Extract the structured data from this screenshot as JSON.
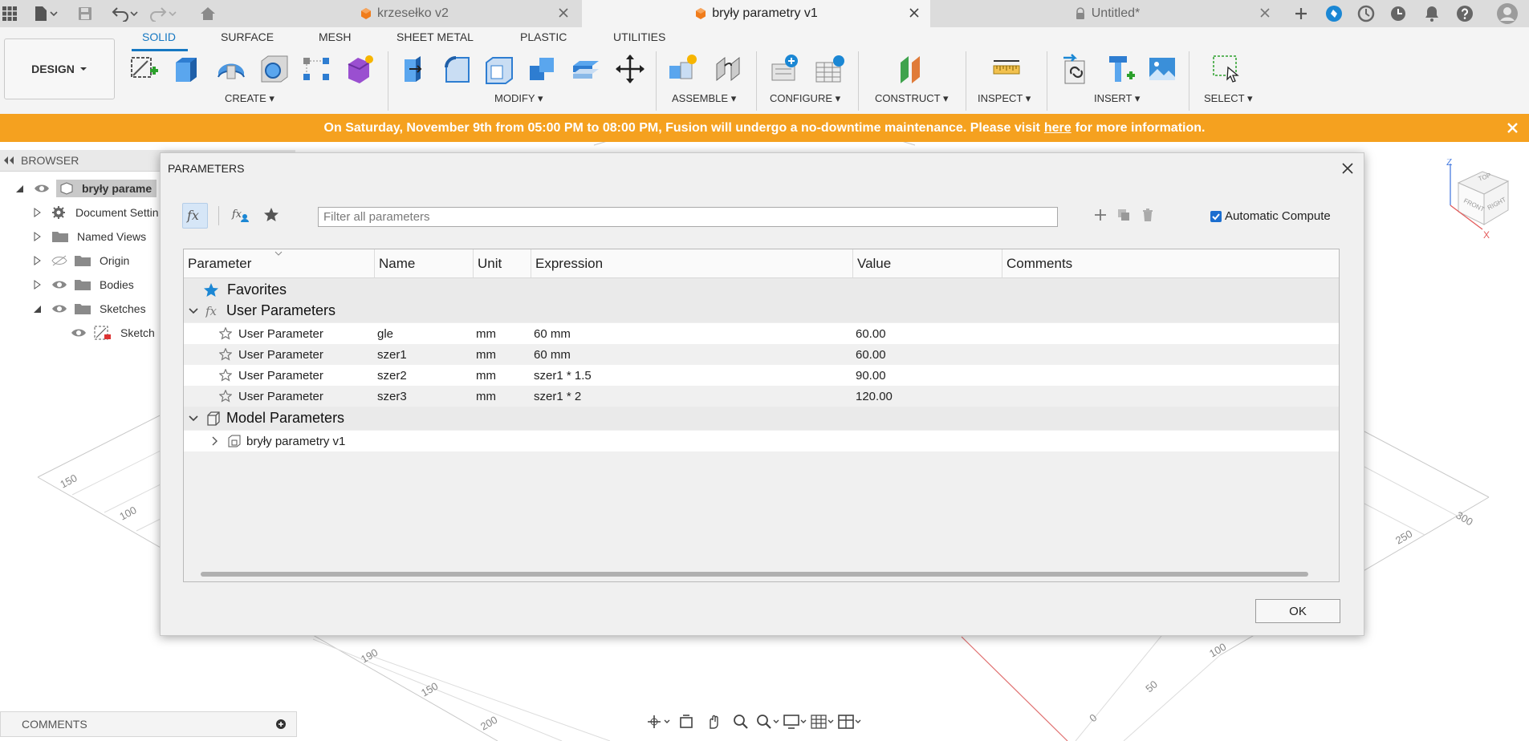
{
  "tabs": [
    {
      "label": "krzesełko v2",
      "active": false
    },
    {
      "label": "bryły parametry v1",
      "active": true
    },
    {
      "label": "Untitled*",
      "active": false,
      "locked": true
    }
  ],
  "workspace": {
    "label": "DESIGN"
  },
  "ribbon_tabs": [
    "SOLID",
    "SURFACE",
    "MESH",
    "SHEET METAL",
    "PLASTIC",
    "UTILITIES"
  ],
  "ribbon_groups": [
    "CREATE",
    "MODIFY",
    "ASSEMBLE",
    "CONFIGURE",
    "CONSTRUCT",
    "INSPECT",
    "INSERT",
    "SELECT"
  ],
  "banner": {
    "text_before": "On Saturday, November 9th from 05:00 PM to 08:00 PM, Fusion will undergo a no-downtime maintenance. Please visit",
    "link": "here",
    "text_after": "for more information.",
    "color": "#f5a11f"
  },
  "browser": {
    "title": "BROWSER",
    "items": [
      {
        "label": "bryły parame"
      },
      {
        "label": "Document Settin"
      },
      {
        "label": "Named Views"
      },
      {
        "label": "Origin"
      },
      {
        "label": "Bodies"
      },
      {
        "label": "Sketches"
      },
      {
        "label": "Sketch"
      }
    ]
  },
  "comments": {
    "label": "COMMENTS"
  },
  "viewcube": {
    "top": "TOP",
    "front": "FRONT",
    "right": "RIGHT",
    "z": "Z",
    "x": "X"
  },
  "grid_labels": [
    "150",
    "100",
    "300",
    "250",
    "100",
    "50",
    "0",
    "190",
    "150",
    "200"
  ],
  "dialog": {
    "title": "PARAMETERS",
    "filter_placeholder": "Filter all parameters",
    "automatic_compute": "Automatic Compute",
    "ok": "OK",
    "columns": [
      "Parameter",
      "Name",
      "Unit",
      "Expression",
      "Value",
      "Comments"
    ],
    "groups": {
      "favorites": "Favorites",
      "user": "User Parameters",
      "model": "Model Parameters"
    },
    "user_params": [
      {
        "type": "User Parameter",
        "name": "gle",
        "unit": "mm",
        "expression": "60 mm",
        "value": "60.00",
        "comment": ""
      },
      {
        "type": "User Parameter",
        "name": "szer1",
        "unit": "mm",
        "expression": "60 mm",
        "value": "60.00",
        "comment": ""
      },
      {
        "type": "User Parameter",
        "name": "szer2",
        "unit": "mm",
        "expression": "szer1 * 1.5",
        "value": "90.00",
        "comment": ""
      },
      {
        "type": "User Parameter",
        "name": "szer3",
        "unit": "mm",
        "expression": "szer1 * 2",
        "value": "120.00",
        "comment": ""
      }
    ],
    "model_components": [
      {
        "label": "bryły parametry v1"
      }
    ]
  }
}
